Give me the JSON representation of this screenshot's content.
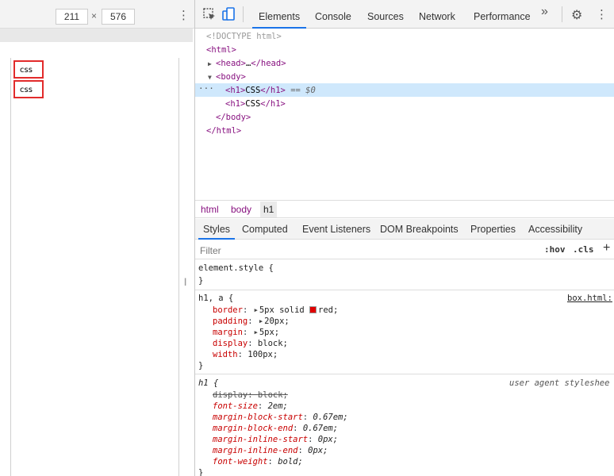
{
  "device_toolbar": {
    "width_value": "211",
    "times_symbol": "×",
    "height_value": "576",
    "more_icon": "⋮"
  },
  "preview": {
    "boxes": [
      "css",
      "css"
    ]
  },
  "devtools": {
    "tabs": [
      "Elements",
      "Console",
      "Sources",
      "Network",
      "Performance"
    ],
    "active_tab": "Elements",
    "more_tabs_icon": "»",
    "settings_icon": "⚙",
    "menu_icon": "⋮"
  },
  "dom_tree": {
    "doctype": "<!DOCTYPE html>",
    "html_open": "<html>",
    "head_open": "<head>",
    "head_ellipsis": "…",
    "head_close": "</head>",
    "body_open": "<body>",
    "h1_open": "<h1>",
    "h1_text": "CSS",
    "h1_close": "</h1>",
    "selected_marker": "== $0",
    "dots": "···",
    "body_close": "</body>",
    "html_close": "</html>"
  },
  "breadcrumb": [
    "html",
    "body",
    "h1"
  ],
  "sub_tabs": [
    "Styles",
    "Computed",
    "Event Listeners",
    "DOM Breakpoints",
    "Properties",
    "Accessibility"
  ],
  "filter": {
    "placeholder": "Filter",
    "hov": ":hov",
    "cls": ".cls",
    "plus": "+"
  },
  "styles": {
    "element_style": {
      "selector": "element.style {",
      "close": "}"
    },
    "rule1": {
      "selector": "h1, a {",
      "source": "box.html:",
      "props": [
        {
          "name": "border",
          "value": "5px solid ",
          "extra": "red;"
        },
        {
          "name": "padding",
          "value": "20px;"
        },
        {
          "name": "margin",
          "value": "5px;"
        },
        {
          "name": "display",
          "value": "block;"
        },
        {
          "name": "width",
          "value": "100px;"
        }
      ],
      "close": "}",
      "swatch_color": "#e00000"
    },
    "rule2": {
      "selector": "h1 {",
      "source": "user agent styleshee",
      "props": [
        {
          "name": "display",
          "value": "block;",
          "overridden": true
        },
        {
          "name": "font-size",
          "value": "2em;"
        },
        {
          "name": "margin-block-start",
          "value": "0.67em;"
        },
        {
          "name": "margin-block-end",
          "value": "0.67em;"
        },
        {
          "name": "margin-inline-start",
          "value": "0px;"
        },
        {
          "name": "margin-inline-end",
          "value": "0px;"
        },
        {
          "name": "font-weight",
          "value": "bold;"
        }
      ],
      "close": "}"
    }
  }
}
